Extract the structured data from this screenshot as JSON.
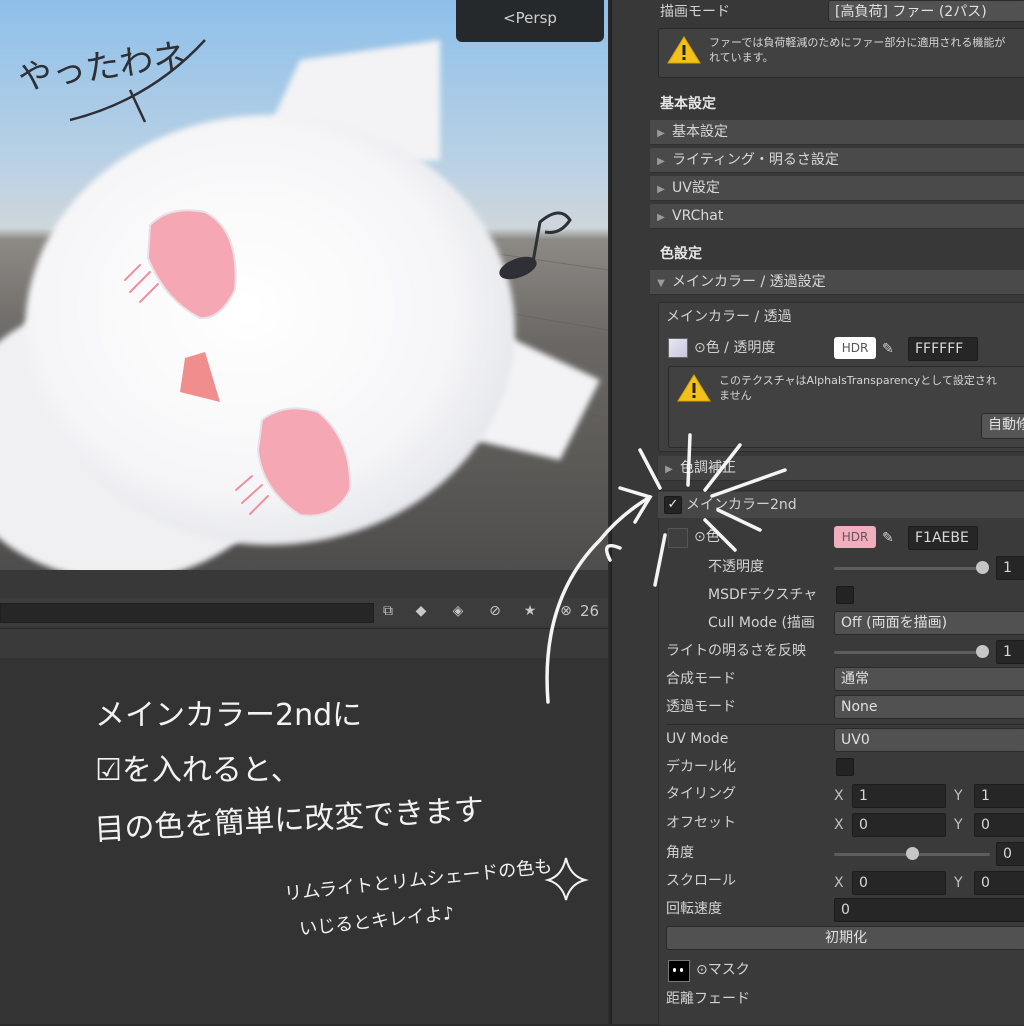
{
  "scene": {
    "view_label": "<Persp",
    "annotation_top": "やったわネ"
  },
  "project": {
    "badge_count": "26",
    "annotation_lines": [
      "メインカラー2ndに",
      "☑を入れると、",
      "目の色を簡単に改変できます"
    ],
    "annotation_small": [
      "リムライトとリムシェードの色も",
      "いじるとキレイよ♪"
    ]
  },
  "inspector": {
    "render_mode_label": "描画モード",
    "render_mode_value": "[高負荷] ファー (2パス)",
    "fur_warning": [
      "ファーでは負荷軽減のためにファー部分に適用される機能が",
      "れています。"
    ],
    "basic_header": "基本設定",
    "basic_folds": [
      "基本設定",
      "ライティング・明るさ設定",
      "UV設定",
      "VRChat"
    ],
    "color_header": "色設定",
    "main_fold": "メインカラー / 透過設定",
    "main_sub_title": "メインカラー / 透過",
    "main_color_label": "⊙色 / 透明度",
    "hdr": "HDR",
    "main_color_hex": "FFFFFF",
    "main_color_swatch": "#FFFFFF",
    "alpha_warning": [
      "このテクスチャはAlphaIsTransparencyとして設定され",
      "ません"
    ],
    "auto_button": "自動修",
    "tone_fold": "色調補正",
    "main2_title": "メインカラー2nd",
    "main2_enabled": true,
    "main2_color_label": "⊙色",
    "main2_color_hex": "F1AEBE",
    "main2_color_swatch": "#F1AEBE",
    "opacity_label": "不透明度",
    "opacity_value": "1",
    "msdf_label": "MSDFテクスチャ",
    "cull_label": "Cull Mode (描画",
    "cull_value": "Off (両面を描画)",
    "light_label": "ライトの明るさを反映",
    "light_value": "1",
    "blend_label": "合成モード",
    "blend_value": "通常",
    "alpha_mode_label": "透過モード",
    "alpha_mode_value": "None",
    "uvmode_label": "UV Mode",
    "uvmode_value": "UV0",
    "decal_label": "デカール化",
    "tiling_label": "タイリング",
    "tiling_x": "1",
    "tiling_y": "1",
    "offset_label": "オフセット",
    "offset_x": "0",
    "offset_y": "0",
    "angle_label": "角度",
    "angle_value": "0",
    "scroll_label": "スクロール",
    "scroll_x": "0",
    "scroll_y": "0",
    "rotate_label": "回転速度",
    "rotate_value": "0",
    "reset_button": "初期化",
    "mask_label": "⊙マスク",
    "distance_fade_label": "距離フェード",
    "x": "X",
    "y": "Y"
  }
}
